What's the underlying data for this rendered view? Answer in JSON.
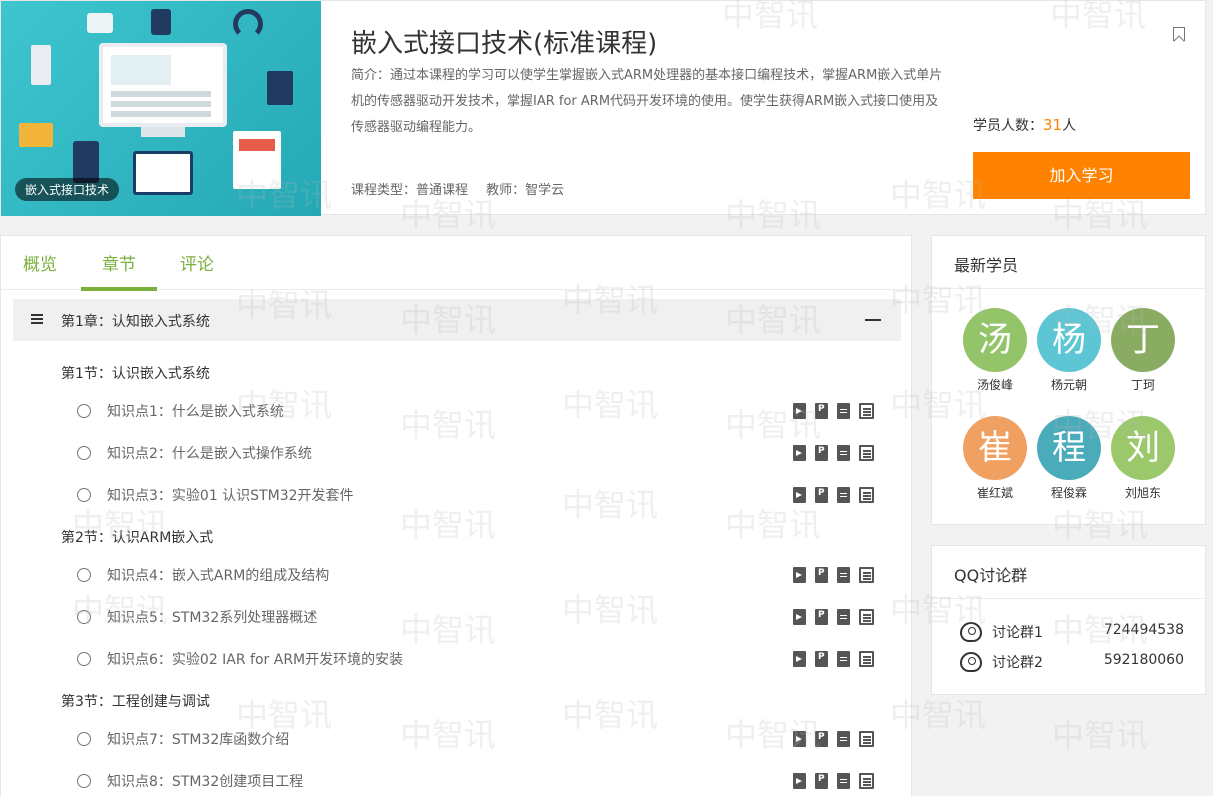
{
  "course": {
    "banner_tag": "嵌入式接口技术",
    "title": "嵌入式接口技术(标准课程)",
    "description": "简介：通过本课程的学习可以使学生掌握嵌入式ARM处理器的基本接口编程技术，掌握ARM嵌入式单片机的传感器驱动开发技术，掌握IAR for ARM代码开发环境的使用。使学生获得ARM嵌入式接口使用及传感器驱动编程能力。",
    "type_label": "课程类型：普通课程",
    "teacher_label": "教师：智学云",
    "student_count_label": "学员人数：",
    "student_count": "31",
    "student_count_unit": "人",
    "join_label": "加入学习"
  },
  "tabs": [
    {
      "label": "概览"
    },
    {
      "label": "章节"
    },
    {
      "label": "评论"
    }
  ],
  "active_tab": 1,
  "chapter": {
    "title": "第1章：认知嵌入式系统"
  },
  "sections": [
    {
      "title": "第1节：认识嵌入式系统",
      "lessons": [
        {
          "label": "知识点1：什么是嵌入式系统"
        },
        {
          "label": "知识点2：什么是嵌入式操作系统"
        },
        {
          "label": "知识点3：实验01 认识STM32开发套件"
        }
      ]
    },
    {
      "title": "第2节：认识ARM嵌入式",
      "lessons": [
        {
          "label": "知识点4：嵌入式ARM的组成及结构"
        },
        {
          "label": "知识点5：STM32系列处理器概述"
        },
        {
          "label": "知识点6：实验02 IAR for ARM开发环境的安装"
        }
      ]
    },
    {
      "title": "第3节：工程创建与调试",
      "lessons": [
        {
          "label": "知识点7：STM32库函数介绍"
        },
        {
          "label": "知识点8：STM32创建项目工程"
        }
      ]
    }
  ],
  "resource_icons": [
    "video-icon",
    "pdf-icon",
    "doc-icon",
    "list-icon"
  ],
  "students_card": {
    "title": "最新学员",
    "students": [
      {
        "char": "汤",
        "name": "汤俊峰",
        "color": "#94c46a"
      },
      {
        "char": "杨",
        "name": "杨元朝",
        "color": "#5cc6d4"
      },
      {
        "char": "丁",
        "name": "丁珂",
        "color": "#8aac62"
      },
      {
        "char": "崔",
        "name": "崔红斌",
        "color": "#f0a060"
      },
      {
        "char": "程",
        "name": "程俊霖",
        "color": "#4aabba"
      },
      {
        "char": "刘",
        "name": "刘旭东",
        "color": "#9cc86c"
      }
    ]
  },
  "qq_card": {
    "title": "QQ讨论群",
    "groups": [
      {
        "name": "讨论群1",
        "number": "724494538"
      },
      {
        "name": "讨论群2",
        "number": "592180060"
      }
    ]
  },
  "watermark": "中智讯",
  "colors": {
    "accent": "#7ab03c",
    "orange": "#ff8200"
  }
}
